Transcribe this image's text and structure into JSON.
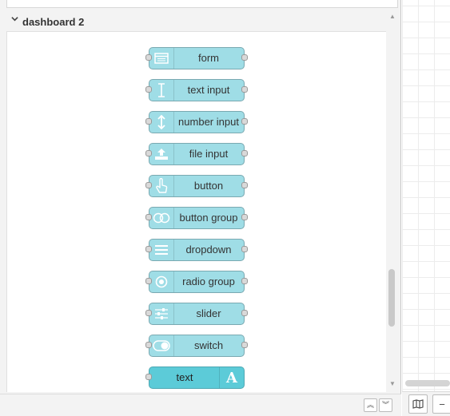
{
  "category": {
    "title": "dashboard 2",
    "chevron": "chevron-down-icon"
  },
  "nodes": [
    {
      "label": "form",
      "icon": "form-icon"
    },
    {
      "label": "text input",
      "icon": "text-cursor-icon"
    },
    {
      "label": "number input",
      "icon": "vertical-arrows-icon"
    },
    {
      "label": "file input",
      "icon": "upload-icon"
    },
    {
      "label": "button",
      "icon": "hand-pointer-icon"
    },
    {
      "label": "button group",
      "icon": "toggle-group-icon"
    },
    {
      "label": "dropdown",
      "icon": "list-icon"
    },
    {
      "label": "radio group",
      "icon": "radio-icon"
    },
    {
      "label": "slider",
      "icon": "sliders-icon"
    },
    {
      "label": "switch",
      "icon": "switch-icon"
    },
    {
      "label": "text",
      "icon": "font-icon",
      "icon_glyph": "A"
    }
  ],
  "colors": {
    "node_fill": "#9fdde6",
    "text_node_fill": "#5ccbd8"
  },
  "footer": {
    "collapse_all_glyph": "︽",
    "expand_all_glyph": "︾"
  },
  "workspace": {
    "zoom_out_glyph": "−"
  }
}
